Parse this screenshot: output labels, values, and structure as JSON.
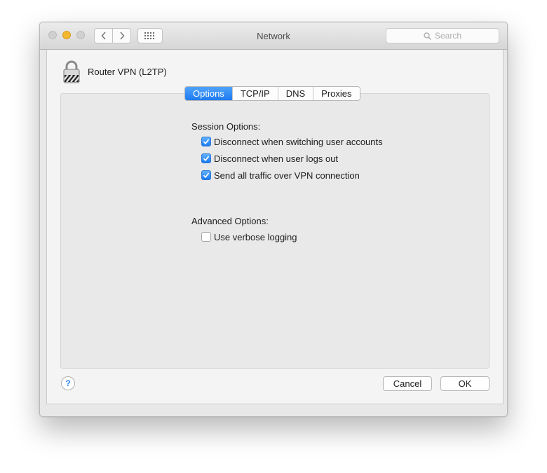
{
  "window": {
    "title": "Network"
  },
  "toolbar": {
    "search_placeholder": "Search"
  },
  "service": {
    "name": "Router VPN (L2TP)"
  },
  "tabs": [
    {
      "label": "Options",
      "active": true
    },
    {
      "label": "TCP/IP",
      "active": false
    },
    {
      "label": "DNS",
      "active": false
    },
    {
      "label": "Proxies",
      "active": false
    }
  ],
  "session": {
    "title": "Session Options:",
    "options": [
      {
        "label": "Disconnect when switching user accounts",
        "checked": true
      },
      {
        "label": "Disconnect when user logs out",
        "checked": true
      },
      {
        "label": "Send all traffic over VPN connection",
        "checked": true
      }
    ]
  },
  "advanced": {
    "title": "Advanced Options:",
    "options": [
      {
        "label": "Use verbose logging",
        "checked": false
      }
    ]
  },
  "footer": {
    "help": "?",
    "cancel": "Cancel",
    "ok": "OK"
  },
  "colors": {
    "accent": "#1f7af0",
    "minimize": "#f5b630"
  }
}
